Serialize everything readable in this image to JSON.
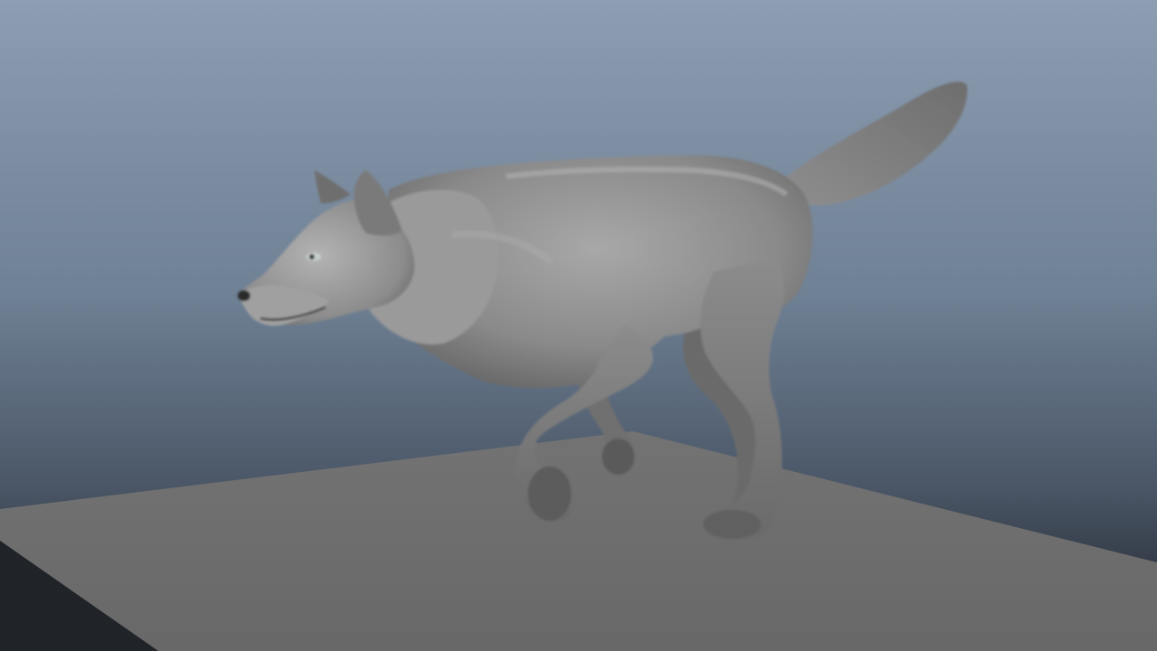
{
  "viewport": {
    "background_top_color": "#8a9bb0",
    "background_bottom_color": "#1c2026",
    "ground_color": "#6b6b6b",
    "subject": "wolf-model"
  },
  "model": {
    "fur_color": "#8f8f8f",
    "fur_shadow_color": "#5e5e5e",
    "fur_highlight_color": "#b9b9b9"
  }
}
